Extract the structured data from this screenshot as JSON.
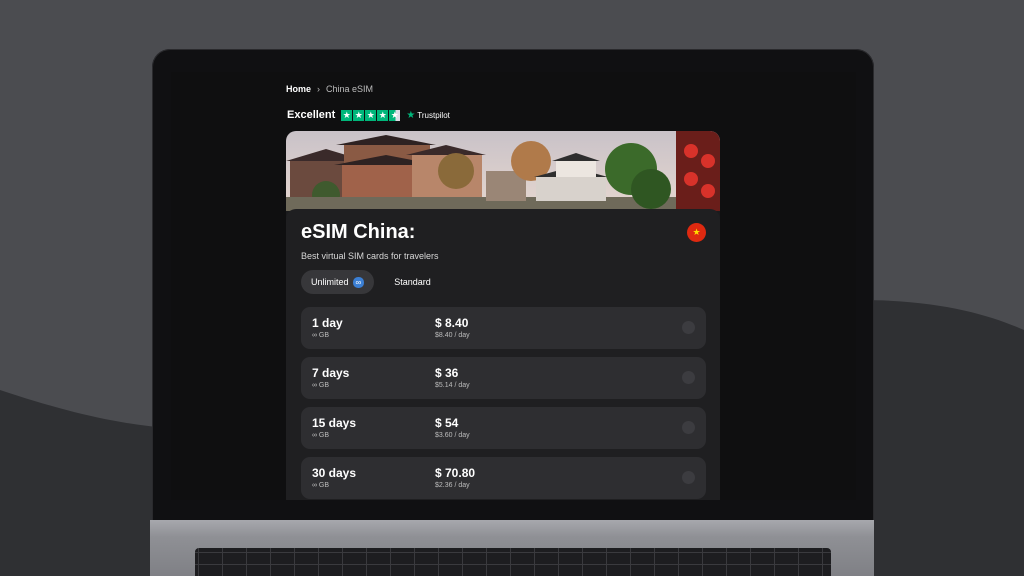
{
  "breadcrumb": {
    "home": "Home",
    "separator": "›",
    "current": "China eSIM"
  },
  "rating": {
    "label": "Excellent",
    "stars": 4.5,
    "provider": "Trustpilot"
  },
  "product": {
    "title": "eSIM China:",
    "subtitle": "Best virtual SIM cards for travelers",
    "flag": "china-flag"
  },
  "tabs": [
    {
      "label": "Unlimited",
      "badge": "∞",
      "active": true
    },
    {
      "label": "Standard",
      "active": false
    }
  ],
  "plans": [
    {
      "days": "1 day",
      "data": "∞ GB",
      "price": "$ 8.40",
      "per_day": "$8.40 / day"
    },
    {
      "days": "7 days",
      "data": "∞ GB",
      "price": "$ 36",
      "per_day": "$5.14 / day"
    },
    {
      "days": "15 days",
      "data": "∞ GB",
      "price": "$ 54",
      "per_day": "$3.60 / day"
    },
    {
      "days": "30 days",
      "data": "∞ GB",
      "price": "$ 70.80",
      "per_day": "$2.36 / day"
    }
  ],
  "colors": {
    "trustpilot": "#00b67a",
    "card": "#1f1f21",
    "plan_row": "#2e2e31",
    "accent_badge": "#3b7fd4"
  }
}
